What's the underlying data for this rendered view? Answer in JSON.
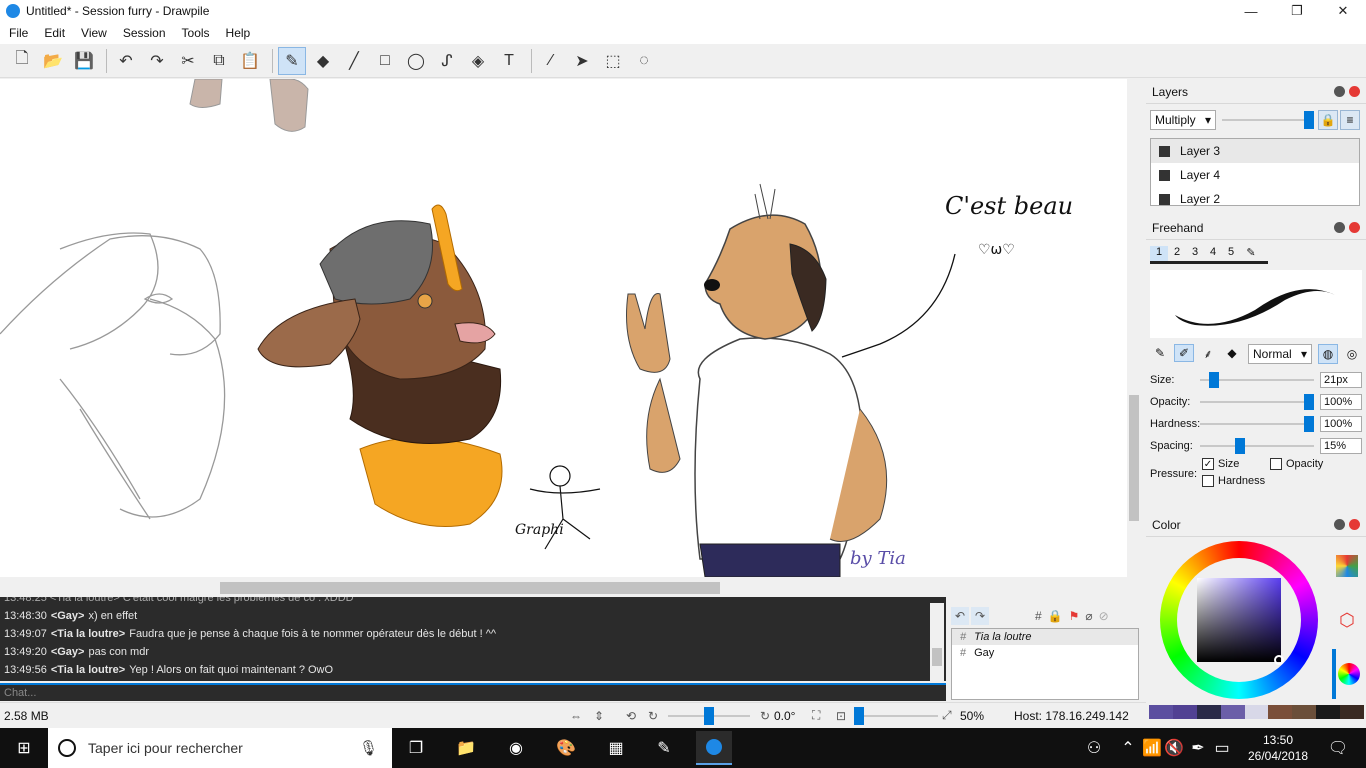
{
  "window": {
    "title": "Untitled* - Session furry - Drawpile",
    "minimize": "—",
    "maximize": "❐",
    "close": "✕"
  },
  "menu": [
    "File",
    "Edit",
    "View",
    "Session",
    "Tools",
    "Help"
  ],
  "toolbar": {
    "icons": [
      "new-icon",
      "open-icon",
      "save-icon",
      "undo-icon",
      "redo-icon",
      "cut-icon",
      "copy-icon",
      "paste-icon",
      "freehand-icon",
      "eraser-icon",
      "line-icon",
      "rectangle-icon",
      "ellipse-icon",
      "bezier-icon",
      "fill-icon",
      "text-icon",
      "picker-icon",
      "move-icon",
      "select-rect-icon",
      "lasso-icon"
    ],
    "glyphs": [
      "🗋",
      "📂",
      "💾",
      "↶",
      "↷",
      "✂",
      "⧉",
      "📋",
      "✎",
      "◆",
      "╱",
      "□",
      "◯",
      "ᔑ",
      "◈",
      "T",
      "⁄",
      "➤",
      "⬚",
      "◌"
    ],
    "active": "freehand-icon"
  },
  "canvas": {
    "text_art": "C'est beau",
    "signature_left": "Graphi",
    "signature_right": "by Tia"
  },
  "layers": {
    "title": "Layers",
    "blend_mode": "Multiply",
    "opacity": 0.97,
    "items": [
      {
        "name": "Layer 3",
        "selected": true
      },
      {
        "name": "Layer 4",
        "selected": false
      },
      {
        "name": "Layer 2",
        "selected": false
      }
    ]
  },
  "freehand": {
    "title": "Freehand",
    "presets": [
      "1",
      "2",
      "3",
      "4",
      "5"
    ],
    "blend": "Normal",
    "size_label": "Size:",
    "size_value": "21px",
    "size_level": 0.12,
    "opacity_label": "Opacity:",
    "opacity_value": "100%",
    "opacity_level": 1.0,
    "hardness_label": "Hardness:",
    "hardness_value": "100%",
    "hardness_level": 1.0,
    "spacing_label": "Spacing:",
    "spacing_value": "15%",
    "spacing_level": 0.35,
    "pressure_label": "Pressure:",
    "pressure_size": "Size",
    "pressure_opacity": "Opacity",
    "pressure_hardness": "Hardness"
  },
  "color": {
    "title": "Color",
    "palette": [
      "#5c4fa0",
      "#514193",
      "#2a2a48",
      "#6b5ea8",
      "#d8d8e8",
      "#7a4f3a",
      "#6b4f3a",
      "#1a1a1a",
      "#3a2a22"
    ]
  },
  "chat": {
    "lines": [
      {
        "time": "13:48:30",
        "nick": "<Gay>",
        "text": "x) en effet",
        "bold": false
      },
      {
        "time": "13:49:07",
        "nick": "<Tia la loutre>",
        "text": "Faudra que je pense à chaque fois à te nommer opérateur dès le début ! ^^",
        "bold": true
      },
      {
        "time": "13:49:20",
        "nick": "<Gay>",
        "text": "pas con mdr",
        "bold": false
      },
      {
        "time": "13:49:56",
        "nick": "<Tia la loutre>",
        "text": "Yep ! Alors on fait quoi maintenant ? OwO",
        "bold": true
      }
    ],
    "input_placeholder": "Chat..."
  },
  "users": [
    {
      "name": "Tia la loutre",
      "italic": true
    },
    {
      "name": "Gay",
      "italic": false
    }
  ],
  "status": {
    "memory": "2.58 MB",
    "rotation": "0.0°",
    "zoom": "50%",
    "host": "Host: 178.16.249.142"
  },
  "taskbar": {
    "search_placeholder": "Taper ici pour rechercher",
    "time": "13:50",
    "date": "26/04/2018"
  }
}
